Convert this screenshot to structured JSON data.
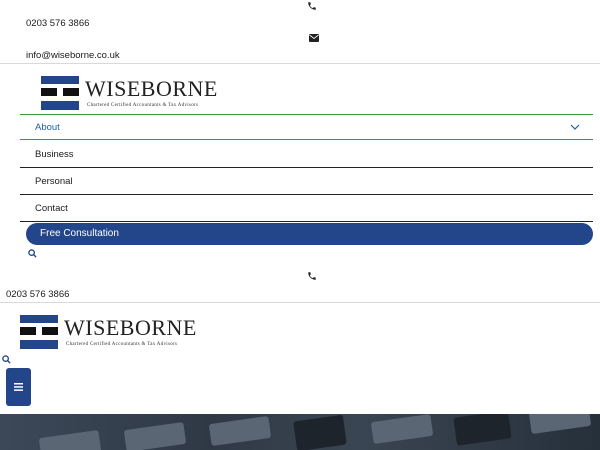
{
  "top_contact": {
    "phone": "0203 576 3866",
    "email": "info@wiseborne.co.uk",
    "phone_icon": "phone-icon",
    "email_icon": "envelope-icon"
  },
  "logo": {
    "name": "WISEBORNE",
    "tagline": "Chartered Certified Accountants & Tax Advisors"
  },
  "menu": {
    "items": [
      {
        "label": "About",
        "active": true,
        "has_dropdown": true
      },
      {
        "label": "Business"
      },
      {
        "label": "Personal"
      },
      {
        "label": "Contact"
      }
    ],
    "cta_label": "Free Consultation"
  },
  "sticky_header": {
    "phone": "0203 576 3866"
  },
  "colors": {
    "brand_blue": "#23468a",
    "active_link": "#1f5fb0",
    "active_border": "#2e9b3d"
  }
}
